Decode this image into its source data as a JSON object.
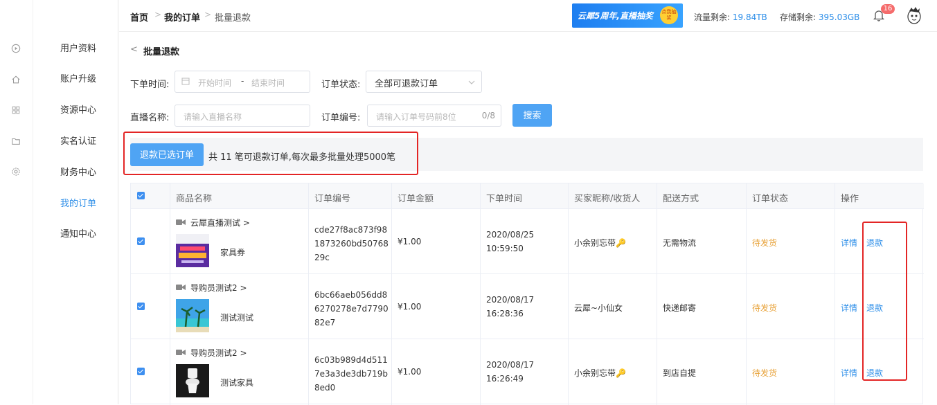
{
  "icon_rail": {
    "icons": [
      "play-circle-icon",
      "home-icon",
      "grid-icon",
      "folder-icon",
      "settings-icon"
    ]
  },
  "sidenav": {
    "items": [
      {
        "label": "用户资料"
      },
      {
        "label": "账户升级"
      },
      {
        "label": "资源中心"
      },
      {
        "label": "实名认证"
      },
      {
        "label": "财务中心"
      },
      {
        "label": "我的订单",
        "active": true
      },
      {
        "label": "通知中心"
      }
    ]
  },
  "breadcrumb": {
    "home": "首页",
    "orders": "我的订单",
    "current": "批量退款"
  },
  "header": {
    "banner_text": "云犀5周年,直播抽奖",
    "banner_badge": "点我抽奖",
    "traffic_label": "流量剩余:",
    "traffic_value": "19.84TB",
    "storage_label": "存储剩余:",
    "storage_value": "395.03GB",
    "notification_count": "16"
  },
  "page": {
    "back_icon": "chevron-left-icon",
    "title": "批量退款"
  },
  "filters": {
    "order_time_label": "下单时间:",
    "start_placeholder": "开始时间",
    "range_sep": "-",
    "end_placeholder": "结束时间",
    "status_label": "订单状态:",
    "status_value": "全部可退款订单",
    "live_name_label": "直播名称:",
    "live_name_placeholder": "请输入直播名称",
    "order_no_label": "订单编号:",
    "order_no_placeholder": "请输入订单号码前8位",
    "order_no_count": "0/8",
    "search_label": "搜索"
  },
  "toolbar": {
    "refund_selected_label": "退款已选订单",
    "summary": "共 11 笔可退款订单,每次最多批量处理5000笔"
  },
  "table": {
    "headers": [
      "商品名称",
      "订单编号",
      "订单金额",
      "下单时间",
      "买家昵称/收货人",
      "配送方式",
      "订单状态",
      "操作"
    ],
    "rows": [
      {
        "live_name": "云犀直播测试 >",
        "product": "家具券",
        "order_no": "cde27f8ac873f981873260bd5076829c",
        "amount": "¥1.00",
        "date": "2020/08/25",
        "time": "10:59:50",
        "buyer": "小余别忘带🔑",
        "delivery": "无需物流",
        "status": "待发货",
        "detail": "详情",
        "refund": "退款"
      },
      {
        "live_name": "导购员测试2 >",
        "product": "测试测试",
        "order_no": "6bc66aeb056dd86270278e7d779082e7",
        "amount": "¥1.00",
        "date": "2020/08/17",
        "time": "16:28:36",
        "buyer": "云犀~小仙女",
        "delivery": "快递邮寄",
        "status": "待发货",
        "detail": "详情",
        "refund": "退款"
      },
      {
        "live_name": "导购员测试2 >",
        "product": "测试家具",
        "order_no": "6c03b989d4d5117e3a3de3db719b8ed0",
        "amount": "¥1.00",
        "date": "2020/08/17",
        "time": "16:26:49",
        "buyer": "小余别忘带🔑",
        "delivery": "到店自提",
        "status": "待发货",
        "detail": "详情",
        "refund": "退款"
      }
    ]
  },
  "colors": {
    "accent": "#2b8de8",
    "button": "#4fa4f4",
    "status": "#e8a33b",
    "highlight": "#e32525"
  }
}
